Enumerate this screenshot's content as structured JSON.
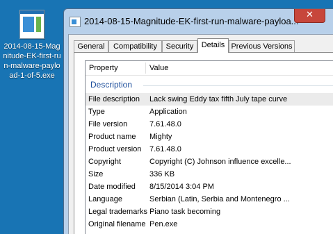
{
  "desktop": {
    "icon_label": "2014-08-15-Magnitude-EK-first-run-malware-payload-1-of-5.exe"
  },
  "window": {
    "title": "2014-08-15-Magnitude-EK-first-run-malware-payloa...",
    "close_glyph": "✕",
    "tabs": [
      {
        "label": "General"
      },
      {
        "label": "Compatibility"
      },
      {
        "label": "Security"
      },
      {
        "label": "Details"
      },
      {
        "label": "Previous Versions"
      }
    ],
    "active_tab": "Details",
    "columns": {
      "property": "Property",
      "value": "Value"
    },
    "group": "Description",
    "rows": [
      {
        "property": "File description",
        "value": "Lack swing Eddy tax fifth July tape curve"
      },
      {
        "property": "Type",
        "value": "Application"
      },
      {
        "property": "File version",
        "value": "7.61.48.0"
      },
      {
        "property": "Product name",
        "value": "Mighty"
      },
      {
        "property": "Product version",
        "value": "7.61.48.0"
      },
      {
        "property": "Copyright",
        "value": "Copyright (C) Johnson influence excelle..."
      },
      {
        "property": "Size",
        "value": "336 KB"
      },
      {
        "property": "Date modified",
        "value": "8/15/2014 3:04 PM"
      },
      {
        "property": "Language",
        "value": "Serbian (Latin, Serbia and Montenegro ..."
      },
      {
        "property": "Legal trademarks",
        "value": "Piano task becoming"
      },
      {
        "property": "Original filename",
        "value": "Pen.exe"
      }
    ]
  }
}
